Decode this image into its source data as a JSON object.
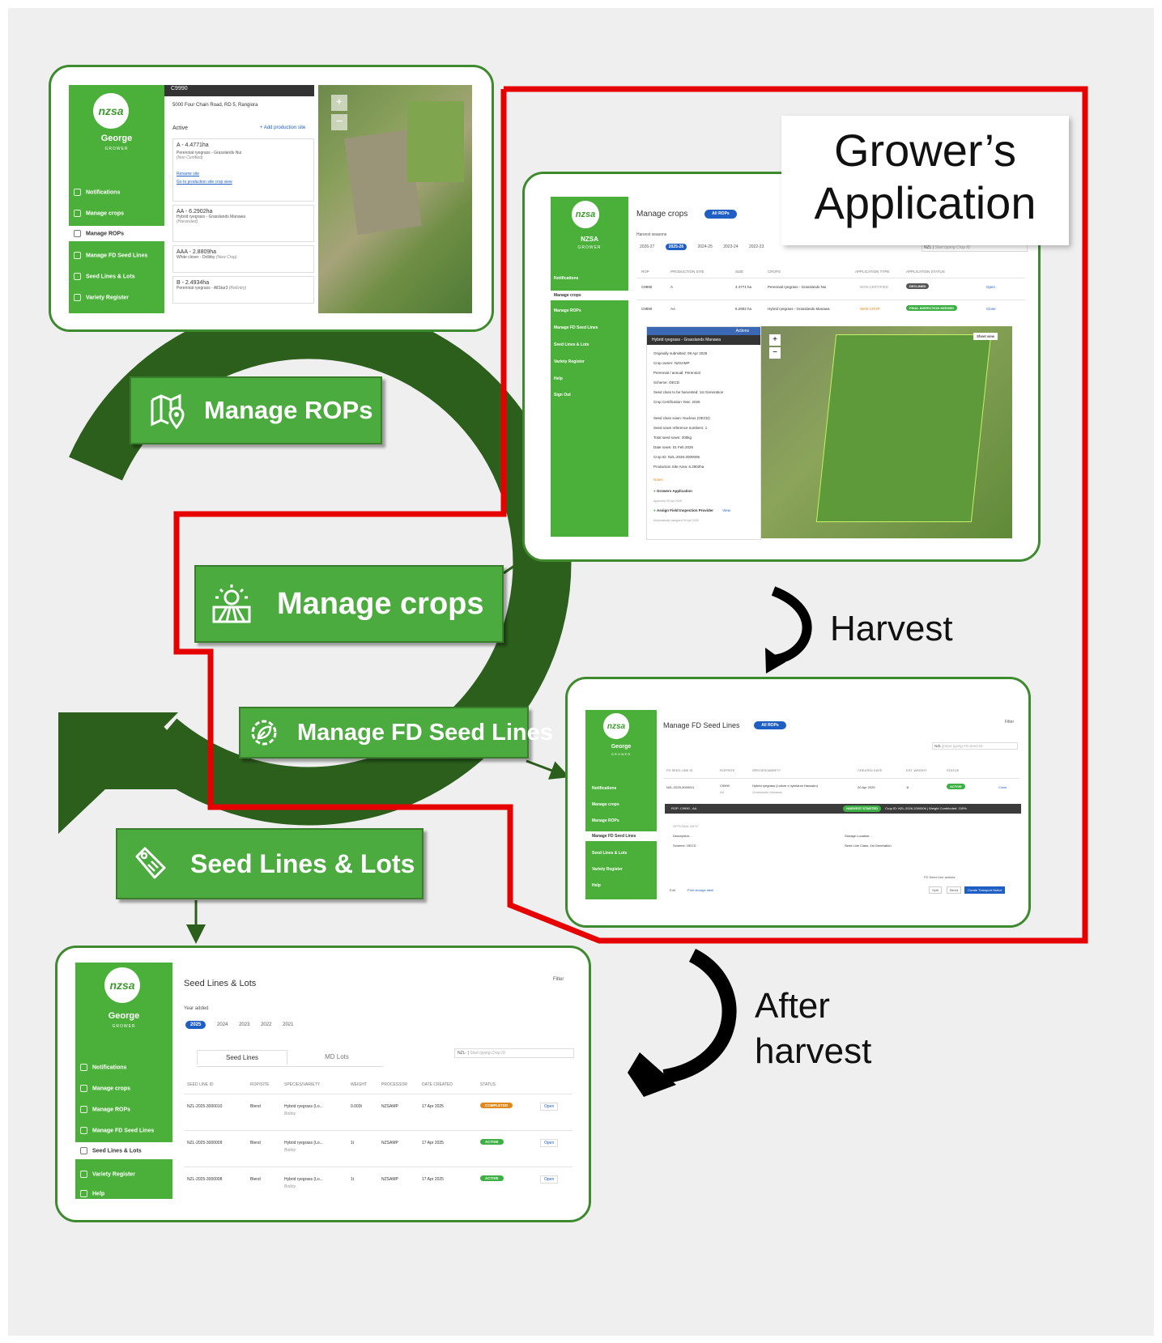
{
  "colors": {
    "sidebar_green": "#4bb03a",
    "label_green": "#4bab3e",
    "arrow_dark_green": "#2c5f1c",
    "panel_border": "#3e8a2e",
    "red_outline": "#e60000",
    "badge_completed": "#e08a1e",
    "badge_active": "#3cb043",
    "badge_declined": "#555555",
    "primary_blue": "#1f5fc4"
  },
  "labels": {
    "manage_rops": "Manage ROPs",
    "manage_crops": "Manage crops",
    "manage_fd_seed_lines": "Manage FD Seed Lines",
    "seed_lines_lots": "Seed Lines & Lots",
    "icons": [
      "map-pin-icon",
      "farm-sun-icon",
      "gear-leaf-icon",
      "seed-tag-icon"
    ]
  },
  "captions": {
    "growers_line1": "Grower’s",
    "growers_line2": "Application",
    "harvest": "Harvest",
    "after_line1": "After",
    "after_line2": "harvest"
  },
  "common": {
    "logo": "nzsa",
    "grower_name": "George",
    "grower_role": "GROWER",
    "nav": {
      "notifications": "Notifications",
      "manage_crops": "Manage crops",
      "manage_rops": "Manage ROPs",
      "manage_fd_seed_lines": "Manage FD Seed Lines",
      "seed_lines_lots": "Seed Lines & Lots",
      "variety_register": "Variety Register",
      "help": "Help",
      "sign_out": "Sign Out"
    }
  },
  "rops_panel": {
    "site_code": "C9990",
    "address": "5000 Four Chain Road, RD 5, Rangiora",
    "active": "Active",
    "add_site": "+ Add production site",
    "sites": [
      {
        "name": "A - 4.4771ha",
        "crop": "Perennial ryegrass - Grasslands Nui",
        "note": "(Non Certified)"
      },
      {
        "name": "AA - 6.2902ha",
        "crop": "Hybrid ryegrass - Grasslands Manawa",
        "note": "(Harvested)"
      },
      {
        "name": "AAA - 2.8809ha",
        "crop": "White clover - Dolbby",
        "note": "(New Crop)"
      },
      {
        "name": "B - 2.4934ha",
        "crop": "Perennial ryegrass - AllStar3",
        "note": "(ReEntry)"
      }
    ],
    "rename_site": "Rename site",
    "go_to": "Go to production site crop view"
  },
  "crops_panel": {
    "org": "NZSA",
    "title": "Manage crops",
    "rops_pill": "All ROPs",
    "harvest_seasons": "Harvest seasons",
    "seasons": [
      "2026-27",
      "2025-26",
      "2024-25",
      "2023-24",
      "2022-23"
    ],
    "search_prefix": "NZL",
    "search_placeholder": "Start typing Crop ID",
    "columns": [
      "ROP",
      "PRODUCTION SITE",
      "SIZE",
      "CROPS",
      "APPLICATION TYPE",
      "APPLICATION STATUS"
    ],
    "rows": [
      {
        "rop": "C9990",
        "site": "A",
        "size": "4.4771 ha",
        "crop": "Perennial ryegrass - Grasslands Nui",
        "type": "NON CERTIFIED",
        "status": "DECLINED",
        "action": "Open"
      },
      {
        "rop": "C9990",
        "site": "AA",
        "size": "6.2902 ha",
        "crop": "Hybrid ryegrass - Grasslands Manawa",
        "type": "NEW CROP",
        "status": "FINAL INSPECTION NEEDED",
        "action": "Close"
      }
    ],
    "actions": "Actions",
    "detail_title": "Hybrid ryegrass - Grasslands Manawa",
    "details": [
      "Originally submitted: 09 Apr 2025",
      "Crop owner: NZSAMP",
      "Perennial / annual: Perennial",
      "Scheme: OECD",
      "Seed class to be harvested: 1st Generation",
      "Crop Certification Year: 2026",
      "Seed class sown: Nucleus (OECD)",
      "Seed sown reference numbers: 1",
      "Total seed sown: 200kg",
      "Date sown: 01 Feb 2025",
      "Crop ID: NZL-2026-2000006",
      "Production Site Area: 6.2902ha"
    ],
    "notes": "Notes",
    "steps": [
      {
        "title": "Growers Application",
        "sub": "Approved 09 Apr 2025"
      },
      {
        "title": "Assign Field Inspection Provider",
        "sub": "Automatically assigned 09 Apr 2025"
      }
    ],
    "view": "View",
    "sheet_view": "Sheet view"
  },
  "fd_panel": {
    "title": "Manage FD Seed Lines",
    "rops_pill": "All ROPs",
    "filter": "Filter",
    "search_prefix": "NZL",
    "search_placeholder": "Start typing FD Seed ID",
    "columns": [
      "FD SEED LINE ID",
      "ROP/SITE",
      "SPECIES/VARIETY",
      "CREATED DATE",
      "EST. WEIGHT",
      "STATUS"
    ],
    "row": {
      "id": "NZL-2025-3000011",
      "rop": "C9990",
      "site": "AA",
      "variety": "Hybrid ryegrass (Lolium x hybridum Hausskn)",
      "variety2": "Grasslands Manawa",
      "date": "20 Apr 2025",
      "weight": "1t",
      "status": "ACTIVE",
      "action": "Close"
    },
    "bar_text": "ROP: C9990 - AA",
    "bar_badge": "HARVEST STARTED",
    "bar_crop": "Crop ID: NZL-2026-2000006",
    "bar_weight": "Weight Contributed: 100%",
    "optional": "OPTIONAL INFO",
    "description": "Description: -",
    "scheme": "Scheme: OECD",
    "storage": "Storage Location: -",
    "seed_class": "Seed Line Class: 1st Generation",
    "actions_label": "FD Seed Line actions:",
    "edit": "Edit",
    "print": "Print storage label",
    "split": "Split",
    "blend": "Blend",
    "transport": "Create Transport Notice"
  },
  "lots_panel": {
    "title": "Seed Lines & Lots",
    "filter": "Filter",
    "year_added": "Year added",
    "years": [
      "2025",
      "2024",
      "2023",
      "2022",
      "2021"
    ],
    "tabs": [
      "Seed Lines",
      "MD Lots"
    ],
    "search_prefix": "NZL-",
    "search_placeholder": "Start typing Crop ID",
    "columns": [
      "SEED LINE ID",
      "ROP/SITE",
      "SPECIES/VARIETY",
      "WEIGHT",
      "PROCESSOR",
      "DATE CREATED",
      "STATUS"
    ],
    "rows": [
      {
        "id": "NZL-2025-3000010",
        "rop": "Blend",
        "variety": "Hybrid ryegrass (Lo...",
        "sub": "Bobby",
        "weight": "0.003t",
        "processor": "NZSAMP",
        "date": "17 Apr 2025",
        "status": "COMPLETED",
        "action": "Open"
      },
      {
        "id": "NZL-2025-3000009",
        "rop": "Blend",
        "variety": "Hybrid ryegrass (Lo...",
        "sub": "Bobby",
        "weight": "1t",
        "processor": "NZSAMP",
        "date": "17 Apr 2025",
        "status": "ACTIVE",
        "action": "Open"
      },
      {
        "id": "NZL-2025-3000008",
        "rop": "Blend",
        "variety": "Hybrid ryegrass (Lo...",
        "sub": "Bobby",
        "weight": "1t",
        "processor": "NZSAMP",
        "date": "17 Apr 2025",
        "status": "ACTIVE",
        "action": "Open"
      }
    ]
  }
}
